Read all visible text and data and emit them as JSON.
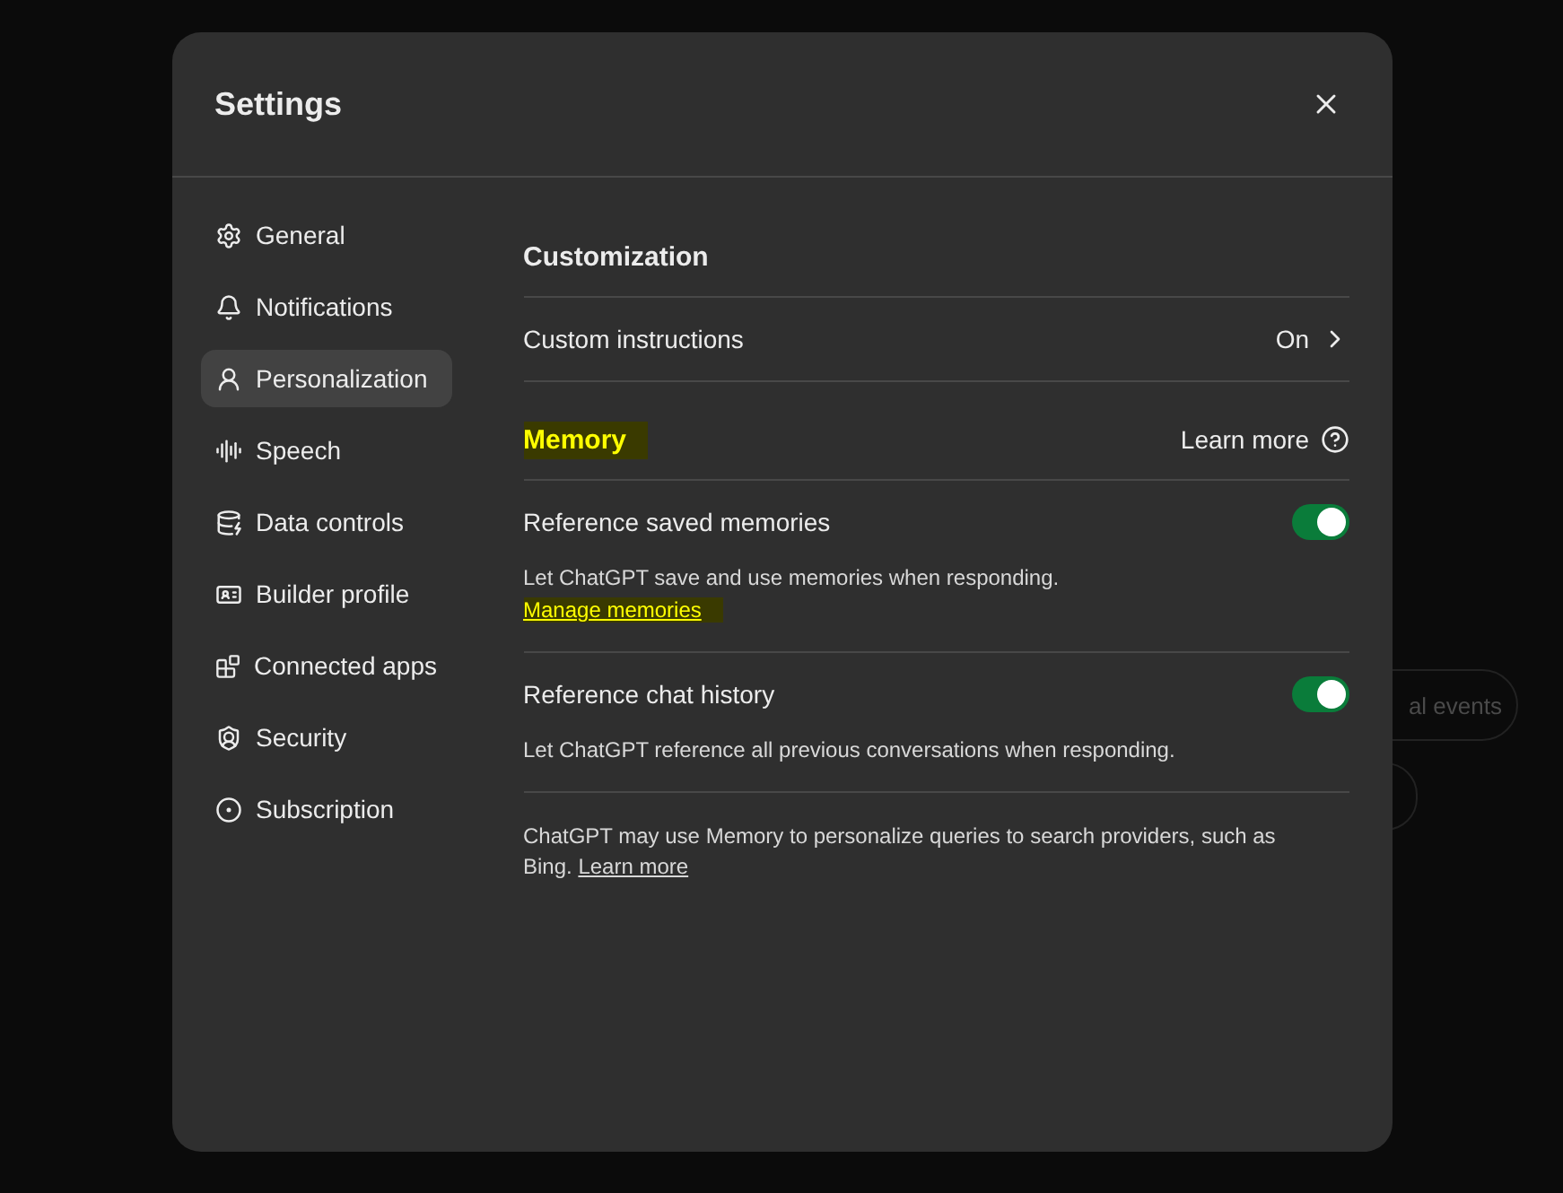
{
  "backdrop": {
    "chips": [
      {
        "label": "al events"
      }
    ]
  },
  "window": {
    "title": "Settings"
  },
  "sidebar": {
    "items": [
      {
        "label": "General",
        "selected": false
      },
      {
        "label": "Notifications",
        "selected": false
      },
      {
        "label": "Personalization",
        "selected": true
      },
      {
        "label": "Speech",
        "selected": false
      },
      {
        "label": "Data controls",
        "selected": false
      },
      {
        "label": "Builder profile",
        "selected": false
      },
      {
        "label": "Connected apps",
        "selected": false
      },
      {
        "label": "Security",
        "selected": false
      },
      {
        "label": "Subscription",
        "selected": false
      }
    ]
  },
  "customization": {
    "heading": "Customization",
    "rows": [
      {
        "label": "Custom instructions",
        "value": "On"
      }
    ]
  },
  "memory": {
    "heading": "Memory",
    "heading_highlighted": true,
    "learn_more": "Learn more",
    "settings": [
      {
        "label": "Reference saved memories",
        "on": true,
        "description": "Let ChatGPT save and use memories when responding.",
        "link": "Manage memories",
        "link_highlighted": true
      },
      {
        "label": "Reference chat history",
        "on": true,
        "description": "Let ChatGPT reference all previous conversations when responding."
      }
    ],
    "footer": "ChatGPT may use Memory to personalize queries to search providers, such as Bing.",
    "footer_link": "Learn more"
  }
}
